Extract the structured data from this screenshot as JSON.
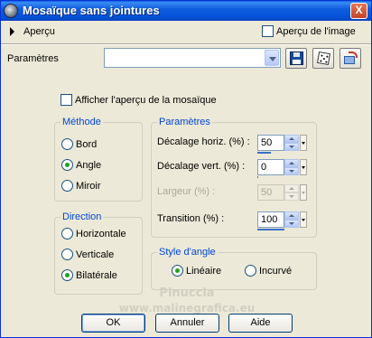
{
  "window": {
    "title": "Mosaïque sans jointures",
    "close_glyph": "X"
  },
  "preview": {
    "label": "Aperçu",
    "image_checkbox_label": "Aperçu de l'image",
    "image_checked": false
  },
  "presets": {
    "label": "Paramètres",
    "selected": ""
  },
  "options": {
    "show_mosaic_label": "Afficher l'aperçu de la mosaïque",
    "show_mosaic_checked": false
  },
  "methode": {
    "title": "Méthode",
    "options": [
      "Bord",
      "Angle",
      "Miroir"
    ],
    "selected": "Angle"
  },
  "parametres": {
    "title": "Paramètres",
    "fields": [
      {
        "label": "Décalage horiz. (%) :",
        "value": "50",
        "enabled": true
      },
      {
        "label": "Décalage vert. (%) :",
        "value": "0",
        "enabled": true
      },
      {
        "label": "Largeur (%) :",
        "value": "50",
        "enabled": false
      },
      {
        "label": "Transition (%) :",
        "value": "100",
        "enabled": true
      }
    ]
  },
  "direction": {
    "title": "Direction",
    "options": [
      "Horizontale",
      "Verticale",
      "Bilatérale"
    ],
    "selected": "Bilatérale"
  },
  "style_angle": {
    "title": "Style d'angle",
    "options": [
      "Linéaire",
      "Incurvé"
    ],
    "selected": "Linéaire"
  },
  "watermark": {
    "line1": "Pinuccia",
    "line2": "www.malinegrafica.eu"
  },
  "buttons": {
    "ok": "OK",
    "cancel": "Annuler",
    "help": "Aide"
  },
  "colors": {
    "group_title": "#0046d5",
    "titlebar": "#0350d6",
    "radio_checked": "#21a121"
  }
}
